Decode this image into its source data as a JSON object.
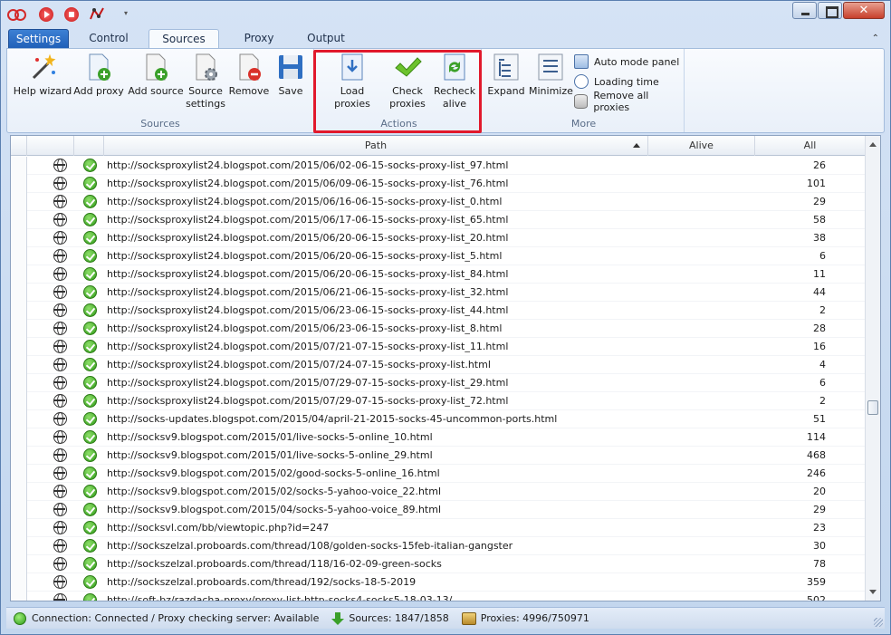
{
  "tabs": [
    "Settings",
    "Control",
    "Sources",
    "Proxy",
    "Output"
  ],
  "ribbon": {
    "sources_group": {
      "label": "Sources",
      "buttons": [
        "Help wizard",
        "Add proxy",
        "Add source",
        "Source settings",
        "Remove",
        "Save"
      ]
    },
    "actions_group": {
      "label": "Actions",
      "buttons": [
        "Load proxies",
        "Check proxies",
        "Recheck alive"
      ]
    },
    "more_group": {
      "label": "More",
      "buttons": [
        "Expand",
        "Minimize"
      ],
      "small_buttons": [
        "Auto mode panel",
        "Loading time",
        "Remove all proxies"
      ]
    }
  },
  "table": {
    "columns": [
      "Path",
      "Alive",
      "All"
    ],
    "rows": [
      {
        "path": "http://socksproxylist24.blogspot.com/2015/06/02-06-15-socks-proxy-list_97.html",
        "all": "26"
      },
      {
        "path": "http://socksproxylist24.blogspot.com/2015/06/09-06-15-socks-proxy-list_76.html",
        "all": "101"
      },
      {
        "path": "http://socksproxylist24.blogspot.com/2015/06/16-06-15-socks-proxy-list_0.html",
        "all": "29"
      },
      {
        "path": "http://socksproxylist24.blogspot.com/2015/06/17-06-15-socks-proxy-list_65.html",
        "all": "58"
      },
      {
        "path": "http://socksproxylist24.blogspot.com/2015/06/20-06-15-socks-proxy-list_20.html",
        "all": "38"
      },
      {
        "path": "http://socksproxylist24.blogspot.com/2015/06/20-06-15-socks-proxy-list_5.html",
        "all": "6"
      },
      {
        "path": "http://socksproxylist24.blogspot.com/2015/06/20-06-15-socks-proxy-list_84.html",
        "all": "11"
      },
      {
        "path": "http://socksproxylist24.blogspot.com/2015/06/21-06-15-socks-proxy-list_32.html",
        "all": "44"
      },
      {
        "path": "http://socksproxylist24.blogspot.com/2015/06/23-06-15-socks-proxy-list_44.html",
        "all": "2"
      },
      {
        "path": "http://socksproxylist24.blogspot.com/2015/06/23-06-15-socks-proxy-list_8.html",
        "all": "28"
      },
      {
        "path": "http://socksproxylist24.blogspot.com/2015/07/21-07-15-socks-proxy-list_11.html",
        "all": "16"
      },
      {
        "path": "http://socksproxylist24.blogspot.com/2015/07/24-07-15-socks-proxy-list.html",
        "all": "4"
      },
      {
        "path": "http://socksproxylist24.blogspot.com/2015/07/29-07-15-socks-proxy-list_29.html",
        "all": "6"
      },
      {
        "path": "http://socksproxylist24.blogspot.com/2015/07/29-07-15-socks-proxy-list_72.html",
        "all": "2"
      },
      {
        "path": "http://socks-updates.blogspot.com/2015/04/april-21-2015-socks-45-uncommon-ports.html",
        "all": "51"
      },
      {
        "path": "http://socksv9.blogspot.com/2015/01/live-socks-5-online_10.html",
        "all": "114"
      },
      {
        "path": "http://socksv9.blogspot.com/2015/01/live-socks-5-online_29.html",
        "all": "468"
      },
      {
        "path": "http://socksv9.blogspot.com/2015/02/good-socks-5-online_16.html",
        "all": "246"
      },
      {
        "path": "http://socksv9.blogspot.com/2015/02/socks-5-yahoo-voice_22.html",
        "all": "20"
      },
      {
        "path": "http://socksv9.blogspot.com/2015/04/socks-5-yahoo-voice_89.html",
        "all": "29"
      },
      {
        "path": "http://socksvl.com/bb/viewtopic.php?id=247",
        "all": "23"
      },
      {
        "path": "http://sockszelzal.proboards.com/thread/108/golden-socks-15feb-italian-gangster",
        "all": "30"
      },
      {
        "path": "http://sockszelzal.proboards.com/thread/118/16-02-09-green-socks",
        "all": "78"
      },
      {
        "path": "http://sockszelzal.proboards.com/thread/192/socks-18-5-2019",
        "all": "359"
      },
      {
        "path": "http://soft-bz/razdacha-proxy/proxy-list-http-socks4-socks5-18-03-13/",
        "all": "502"
      }
    ]
  },
  "status": {
    "connection": "Connection: Connected / Proxy checking server: Available",
    "sources": "Sources: 1847/1858",
    "proxies": "Proxies: 4996/750971"
  },
  "colors": {
    "accent": "#2160b8",
    "highlight": "#e1192c",
    "ok_green": "#2f9a18"
  }
}
